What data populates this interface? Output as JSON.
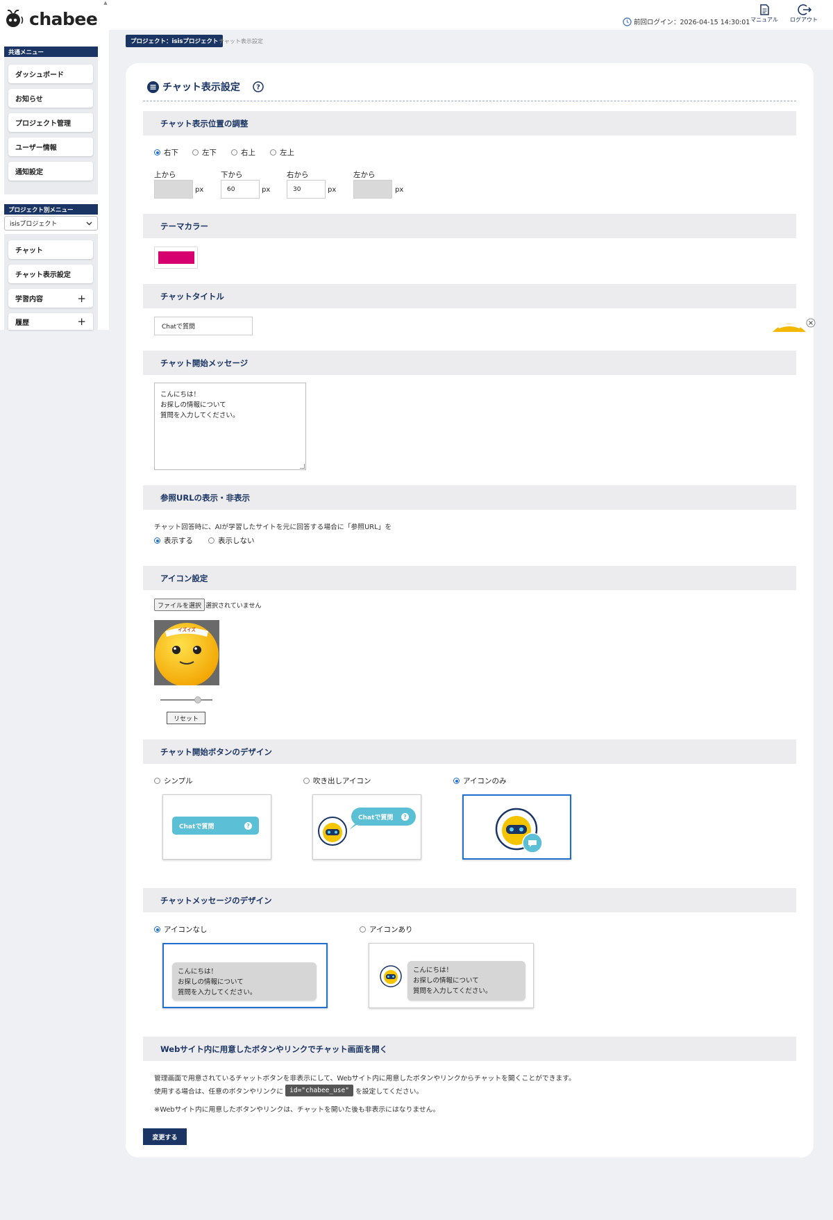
{
  "brand": {
    "name": "chabee"
  },
  "sidebar": {
    "common_menu_label": "共通メニュー",
    "common_items": [
      "ダッシュボード",
      "お知らせ",
      "プロジェクト管理",
      "ユーザー情報",
      "通知設定"
    ],
    "project_menu_label": "プロジェクト別メニュー",
    "project_select": "isisプロジェクト",
    "project_items": [
      "チャット",
      "チャット表示設定",
      "学習内容",
      "履歴"
    ]
  },
  "header": {
    "last_login": "前回ログイン：2026-04-15 14:30:01",
    "manual_label": "マニュアル",
    "logout_label": "ログアウト"
  },
  "breadcrumb": {
    "project": "プロジェクト：isisプロジェクト",
    "current": "チャット表示設定"
  },
  "page": {
    "title": "チャット表示設定"
  },
  "position": {
    "heading": "チャット表示位置の調整",
    "options": [
      "右下",
      "左下",
      "右上",
      "左上"
    ],
    "selected": "右下",
    "fields": [
      {
        "label": "上から",
        "value": "",
        "unit": "px",
        "disabled": true
      },
      {
        "label": "下から",
        "value": "60",
        "unit": "px",
        "disabled": false
      },
      {
        "label": "右から",
        "value": "30",
        "unit": "px",
        "disabled": false
      },
      {
        "label": "左から",
        "value": "",
        "unit": "px",
        "disabled": true
      }
    ]
  },
  "theme": {
    "heading": "テーマカラー",
    "color": "#d6006f"
  },
  "chat_title": {
    "heading": "チャットタイトル",
    "value": "Chatで質問"
  },
  "start_message": {
    "heading": "チャット開始メッセージ",
    "value": "こんにちは！\nお探しの情報について\n質問を入力してください。"
  },
  "ref_url": {
    "heading": "参照URLの表示・非表示",
    "description": "チャット回答時に、AIが学習したサイトを元に回答する場合に「参照URL」を",
    "options": [
      "表示する",
      "表示しない"
    ],
    "selected": "表示する"
  },
  "icon_settings": {
    "heading": "アイコン設定",
    "file_button": "ファイルを選択",
    "file_status": "選択されていません",
    "badge_text": "イズイズ",
    "reset_label": "リセット",
    "zoom_level": 0.72
  },
  "button_design": {
    "heading": "チャット開始ボタンのデザイン",
    "options": [
      "シンプル",
      "吹き出しアイコン",
      "アイコンのみ"
    ],
    "selected": "アイコンのみ",
    "button_text": "Chatで質問"
  },
  "message_design": {
    "heading": "チャットメッセージのデザイン",
    "options": [
      "アイコンなし",
      "アイコンあり"
    ],
    "selected": "アイコンなし",
    "sample": "こんにちは！\nお探しの情報について\n質問を入力してください。"
  },
  "custom_link": {
    "heading": "Webサイト内に用意したボタンやリンクでチャット画面を開く",
    "line1": "管理画面で用意されているチャットボタンを非表示にして、Webサイト内に用意したボタンやリンクからチャットを開くことができます。",
    "line2_pre": "使用する場合は、任意のボタンやリンクに",
    "code": "id=\"chabee_use\"",
    "line2_post": "を設定してください。",
    "line3": "※Webサイト内に用意したボタンやリンクは、チャットを開いた後も非表示にはなりません。"
  },
  "submit_label": "変更する",
  "icons": {
    "page_title_icon": "list-circle-icon",
    "help_icon": "question-circle-icon",
    "clock_icon": "clock-icon",
    "manual_icon": "document-icon",
    "logout_icon": "logout-icon",
    "select_icon": "chevron-down-icon",
    "expand_icon": "plus-icon",
    "close_icon": "close-circle-icon"
  },
  "colors": {
    "navy": "#1a3463",
    "accent_blue": "#1f6fd1",
    "cyan": "#5bbfd6",
    "theme": "#d6006f"
  }
}
